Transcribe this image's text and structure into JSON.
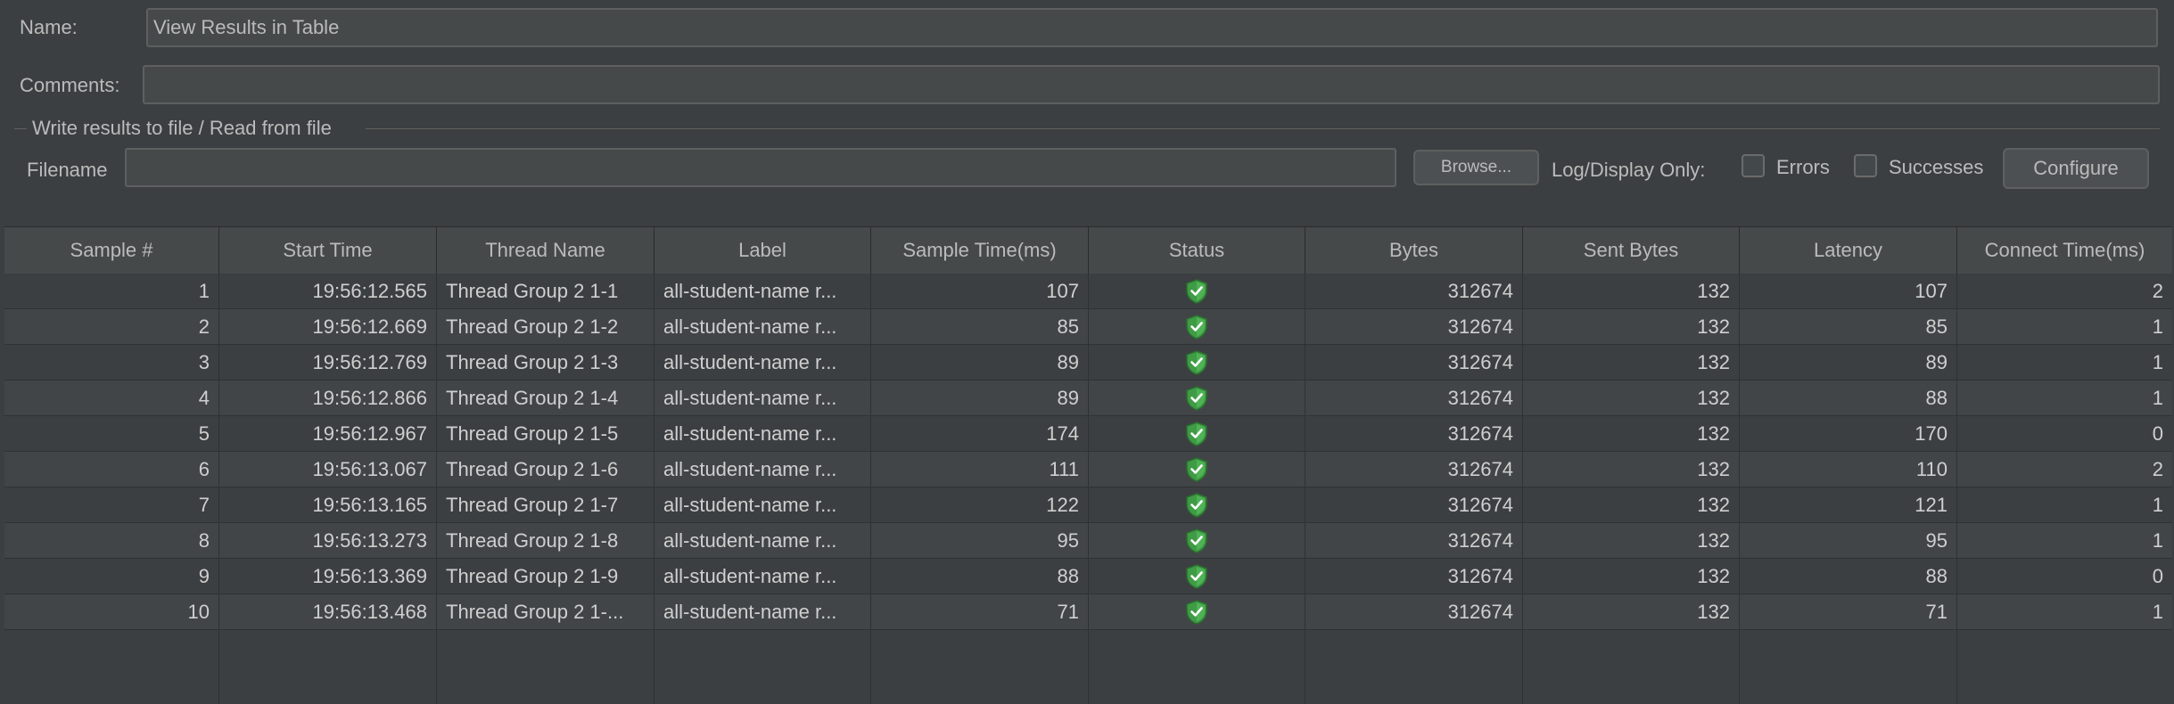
{
  "form": {
    "name_label": "Name:",
    "name_value": "View Results in Table",
    "comments_label": "Comments:",
    "comments_value": "",
    "file_group_title": "Write results to file / Read from file",
    "filename_label": "Filename",
    "filename_value": "",
    "browse_label": "Browse...",
    "log_display_label": "Log/Display Only:",
    "errors_label": "Errors",
    "successes_label": "Successes",
    "configure_label": "Configure"
  },
  "table": {
    "columns": [
      "Sample #",
      "Start Time",
      "Thread Name",
      "Label",
      "Sample Time(ms)",
      "Status",
      "Bytes",
      "Sent Bytes",
      "Latency",
      "Connect Time(ms)"
    ],
    "rows": [
      {
        "sample": "1",
        "start": "19:56:12.565",
        "thread": "Thread Group 2 1-1",
        "label": "all-student-name r...",
        "time": "107",
        "status": "success-shield-icon",
        "bytes": "312674",
        "sent": "132",
        "latency": "107",
        "connect": "2"
      },
      {
        "sample": "2",
        "start": "19:56:12.669",
        "thread": "Thread Group 2 1-2",
        "label": "all-student-name r...",
        "time": "85",
        "status": "success-shield-icon",
        "bytes": "312674",
        "sent": "132",
        "latency": "85",
        "connect": "1"
      },
      {
        "sample": "3",
        "start": "19:56:12.769",
        "thread": "Thread Group 2 1-3",
        "label": "all-student-name r...",
        "time": "89",
        "status": "success-shield-icon",
        "bytes": "312674",
        "sent": "132",
        "latency": "89",
        "connect": "1"
      },
      {
        "sample": "4",
        "start": "19:56:12.866",
        "thread": "Thread Group 2 1-4",
        "label": "all-student-name r...",
        "time": "89",
        "status": "success-shield-icon",
        "bytes": "312674",
        "sent": "132",
        "latency": "88",
        "connect": "1"
      },
      {
        "sample": "5",
        "start": "19:56:12.967",
        "thread": "Thread Group 2 1-5",
        "label": "all-student-name r...",
        "time": "174",
        "status": "success-shield-icon",
        "bytes": "312674",
        "sent": "132",
        "latency": "170",
        "connect": "0"
      },
      {
        "sample": "6",
        "start": "19:56:13.067",
        "thread": "Thread Group 2 1-6",
        "label": "all-student-name r...",
        "time": "111",
        "status": "success-shield-icon",
        "bytes": "312674",
        "sent": "132",
        "latency": "110",
        "connect": "2"
      },
      {
        "sample": "7",
        "start": "19:56:13.165",
        "thread": "Thread Group 2 1-7",
        "label": "all-student-name r...",
        "time": "122",
        "status": "success-shield-icon",
        "bytes": "312674",
        "sent": "132",
        "latency": "121",
        "connect": "1"
      },
      {
        "sample": "8",
        "start": "19:56:13.273",
        "thread": "Thread Group 2 1-8",
        "label": "all-student-name r...",
        "time": "95",
        "status": "success-shield-icon",
        "bytes": "312674",
        "sent": "132",
        "latency": "95",
        "connect": "1"
      },
      {
        "sample": "9",
        "start": "19:56:13.369",
        "thread": "Thread Group 2 1-9",
        "label": "all-student-name r...",
        "time": "88",
        "status": "success-shield-icon",
        "bytes": "312674",
        "sent": "132",
        "latency": "88",
        "connect": "0"
      },
      {
        "sample": "10",
        "start": "19:56:13.468",
        "thread": "Thread Group 2 1-...",
        "label": "all-student-name r...",
        "time": "71",
        "status": "success-shield-icon",
        "bytes": "312674",
        "sent": "132",
        "latency": "71",
        "connect": "1"
      }
    ]
  },
  "colors": {
    "background": "#3c3f41",
    "text": "#bbbbbb",
    "success": "#4caf50"
  }
}
